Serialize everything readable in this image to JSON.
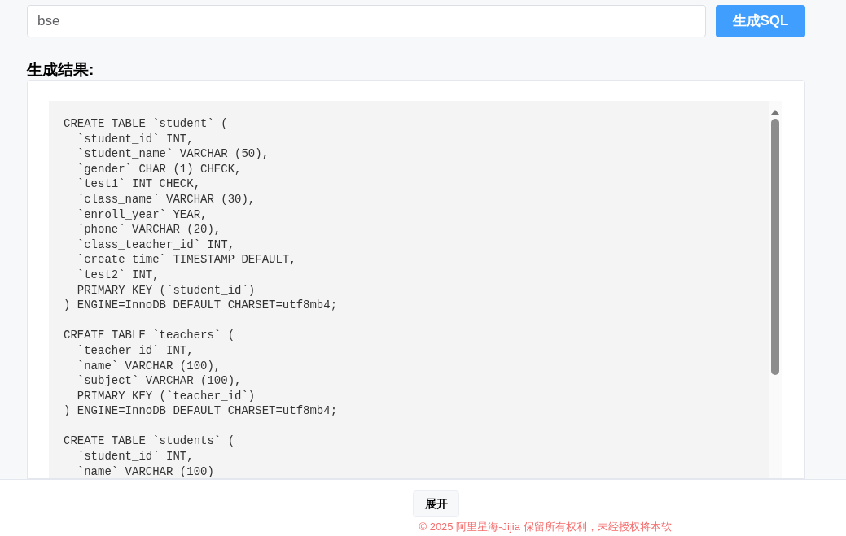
{
  "query_field": {
    "value": "bse"
  },
  "generate_button": {
    "label": "生成SQL"
  },
  "result": {
    "heading": "生成结果:",
    "code_blocks": [
      [
        "CREATE TABLE `student` (",
        "  `student_id` INT,",
        "  `student_name` VARCHAR (50),",
        "  `gender` CHAR (1) CHECK,",
        "  `test1` INT CHECK,",
        "  `class_name` VARCHAR (30),",
        "  `enroll_year` YEAR,",
        "  `phone` VARCHAR (20),",
        "  `class_teacher_id` INT,",
        "  `create_time` TIMESTAMP DEFAULT,",
        "  `test2` INT,",
        "  PRIMARY KEY (`student_id`)",
        ") ENGINE=InnoDB DEFAULT CHARSET=utf8mb4;"
      ],
      [
        "CREATE TABLE `teachers` (",
        "  `teacher_id` INT,",
        "  `name` VARCHAR (100),",
        "  `subject` VARCHAR (100),",
        "  PRIMARY KEY (`teacher_id`)",
        ") ENGINE=InnoDB DEFAULT CHARSET=utf8mb4;"
      ],
      [
        "CREATE TABLE `students` (",
        "  `student_id` INT,",
        "  `name` VARCHAR (100)"
      ]
    ]
  },
  "footer": {
    "expand_button": {
      "label": "展开"
    },
    "copyright": "© 2025 阿里星海-Jijia 保留所有权利，未经授权将本软"
  }
}
